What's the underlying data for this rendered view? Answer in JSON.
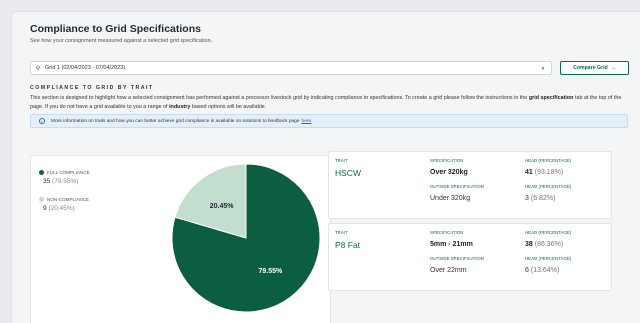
{
  "page": {
    "title": "Compliance to Grid Specifications",
    "subtitle": "See how your consignment measured against a selected grid specification."
  },
  "grid_select": {
    "value": "Grid 1 (02/04/2023 - 07/04/2023)"
  },
  "compare_button": {
    "label": "Compare Grid",
    "icon": "arrow-right-icon"
  },
  "section": {
    "heading": "COMPLIANCE TO GRID BY TRAIT",
    "desc_1": "This section is designed to highlight how a selected consignment has performed against a processor livestock grid by indicating compliance to specifications. To create a grid please follow the instructions in the ",
    "desc_bold_1": "grid specification",
    "desc_2": " tab at the top of the page. If you do not have a grid available to you a range of ",
    "desc_bold_2": "industry",
    "desc_3": " based options will be available."
  },
  "info": {
    "text": "More information on traits and how you can better achieve grid compliance is available on solutions to feedback page",
    "link": "here"
  },
  "legend": {
    "full": {
      "label": "FULL COMPLIANCE",
      "count": "35",
      "pct": "(79.55%)"
    },
    "non": {
      "label": "NON-COMPLIANCE",
      "count": "9",
      "pct": "(20.45%)"
    }
  },
  "chart_data": {
    "type": "pie",
    "slices": [
      {
        "label": "FULL COMPLIANCE",
        "value": 79.55,
        "text": "79.55%",
        "color": "#0b5e3f"
      },
      {
        "label": "NON-COMPLIANCE",
        "value": 20.45,
        "text": "20.45%",
        "color": "#c2decf"
      }
    ]
  },
  "trait_headers": {
    "trait": "TRAIT",
    "spec": "SPECIFICATION",
    "head": "HEAD (PERCENTAGE)",
    "outside": "OUTSIDE SPECIFICATION"
  },
  "traits": [
    {
      "name": "HSCW",
      "spec": "Over 320kg",
      "head": "41",
      "head_pct": "(93.18%)",
      "outside": "Under 320kg",
      "out_head": "3",
      "out_pct": "(6.82%)"
    },
    {
      "name": "P8 Fat",
      "spec": "5mm - 21mm",
      "head": "38",
      "head_pct": "(86.36%)",
      "outside": "Over 22mm",
      "out_head": "6",
      "out_pct": "(13.64%)"
    }
  ],
  "colors": {
    "accent": "#0c6b46",
    "pie_dark": "#0b5e3f",
    "pie_light": "#c2decf",
    "info_bg": "#e4effa"
  }
}
